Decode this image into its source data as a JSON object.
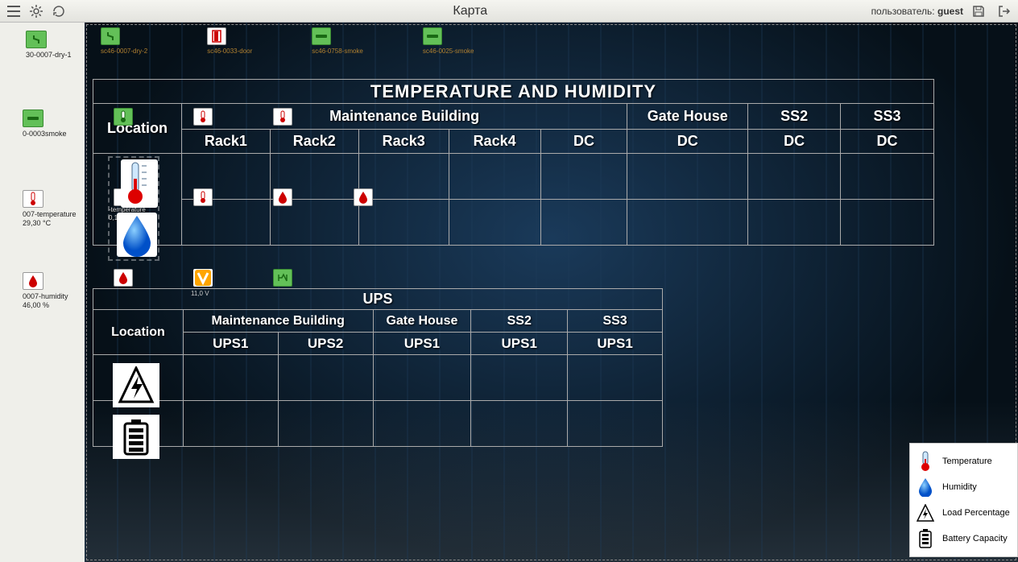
{
  "toolbar": {
    "title": "Карта",
    "user_prefix": "пользователь: ",
    "user_name": "guest"
  },
  "sidebar": {
    "items": [
      {
        "label": "30-0007-dry-1",
        "value": ""
      },
      {
        "label": "0-0003smoke",
        "value": ""
      },
      {
        "label": "007-temperature",
        "value": "29,30 °C"
      },
      {
        "label": "0007-humidity",
        "value": "46,00 %"
      }
    ]
  },
  "top_sensors": [
    {
      "label": "sc46-0007-dry-2"
    },
    {
      "label": "sc46-0033-door"
    },
    {
      "label": "sc46-0758-smoke"
    },
    {
      "label": "sc46-0025-smoke"
    }
  ],
  "table1": {
    "title": "TEMPERATURE AND HUMIDITY",
    "loc_label": "Location",
    "groups": [
      {
        "name": "Maintenance Building",
        "cols": [
          "Rack1",
          "Rack2",
          "Rack3",
          "Rack4",
          "DC"
        ]
      },
      {
        "name": "Gate House",
        "cols": [
          "DC"
        ]
      },
      {
        "name": "SS2",
        "cols": [
          "DC"
        ]
      },
      {
        "name": "SS3",
        "cols": [
          "DC"
        ]
      }
    ],
    "overlay_label1": "-temperature",
    "overlay_label2": "0,10 °C"
  },
  "table2": {
    "title": "UPS",
    "loc_label": "Location",
    "groups": [
      {
        "name": "Maintenance Building",
        "cols": [
          "UPS1",
          "UPS2"
        ]
      },
      {
        "name": "Gate House",
        "cols": [
          "UPS1"
        ]
      },
      {
        "name": "SS2",
        "cols": [
          "UPS1"
        ]
      },
      {
        "name": "SS3",
        "cols": [
          "UPS1"
        ]
      }
    ],
    "row_sensor_value": "11,0 V"
  },
  "legend": {
    "items": [
      "Temperature",
      "Humidity",
      "Load Percentage",
      "Battery Capacity"
    ]
  }
}
